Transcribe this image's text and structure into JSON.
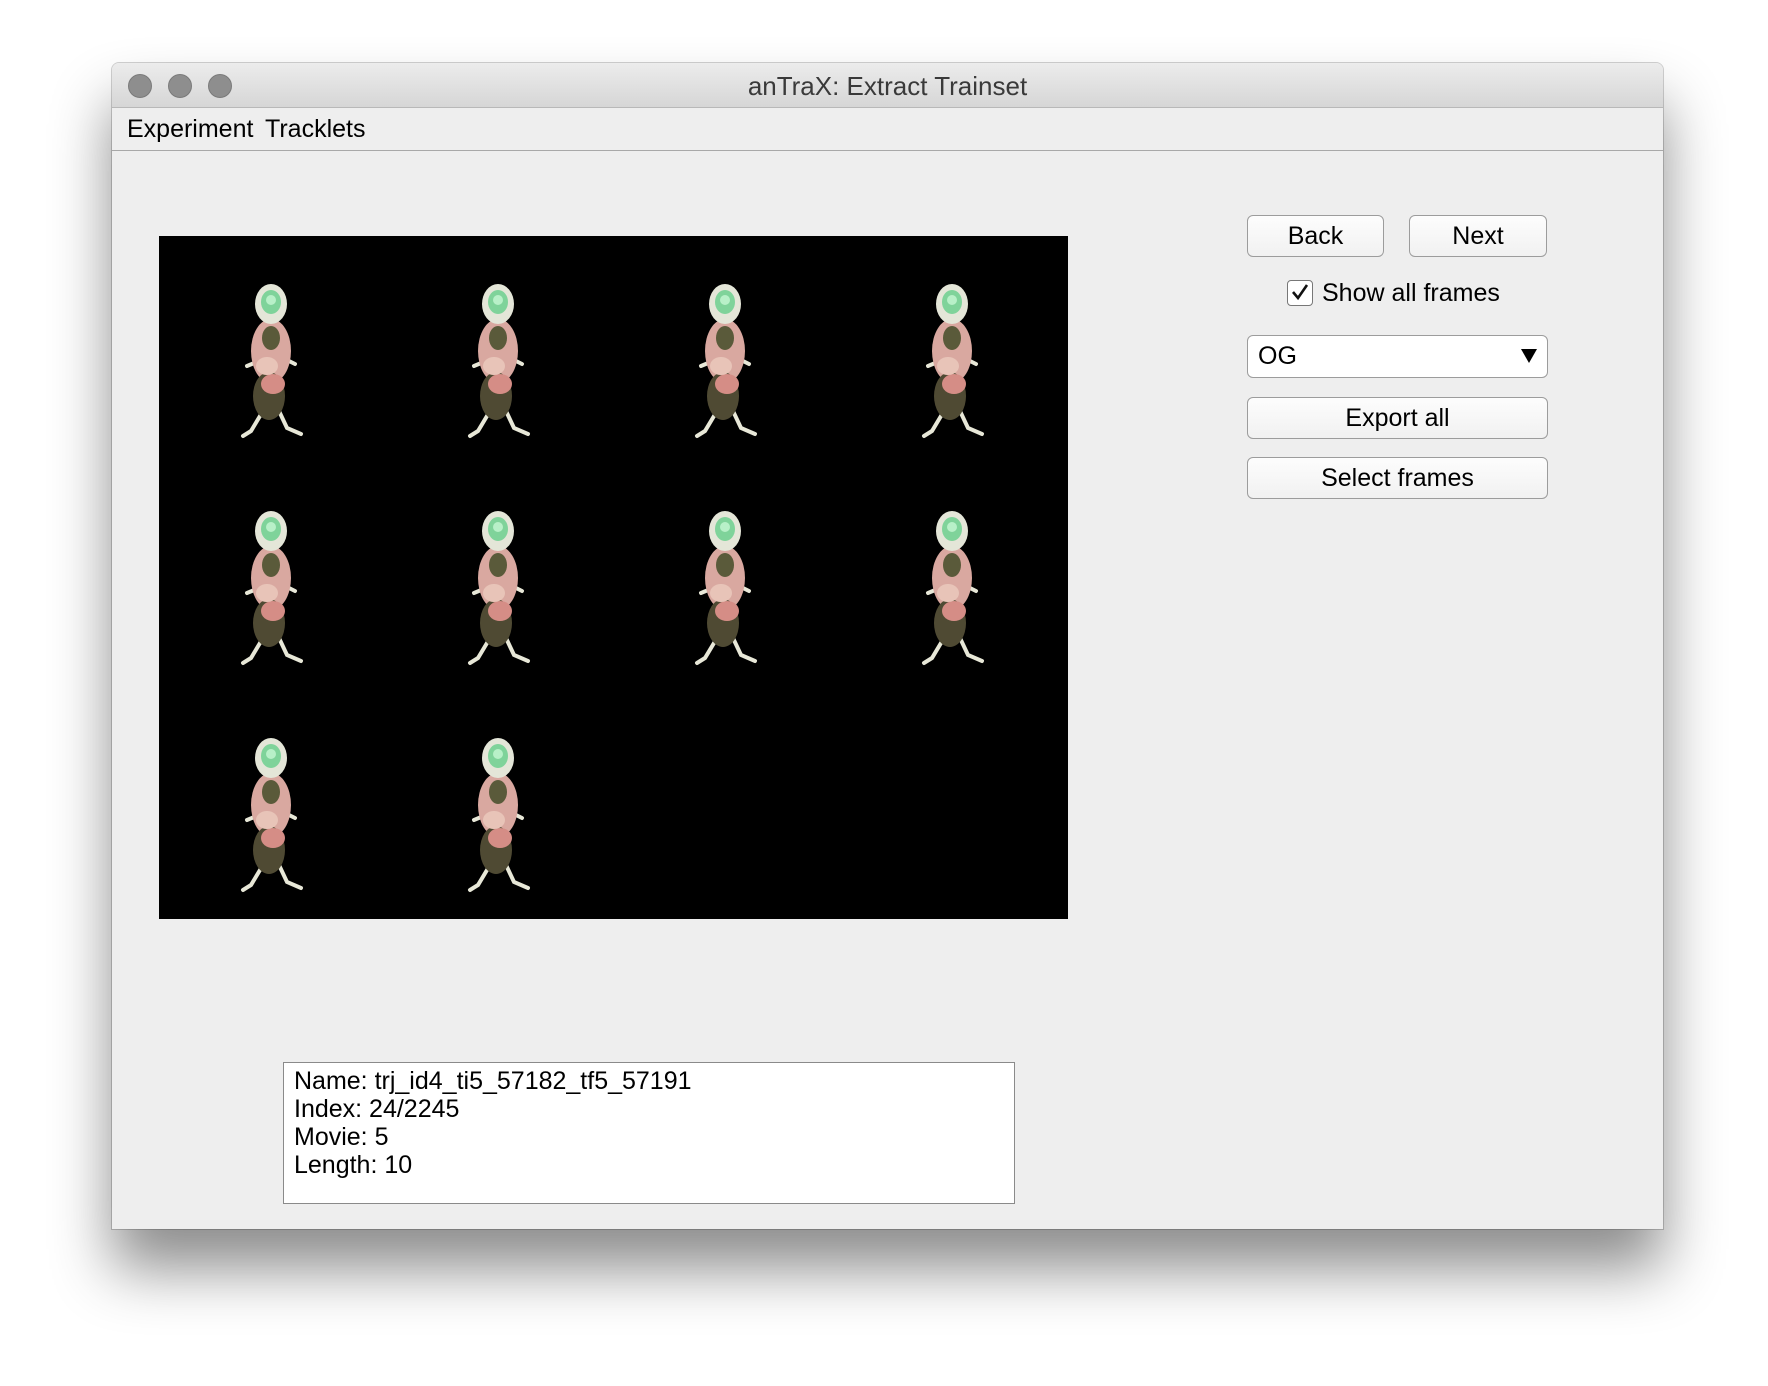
{
  "window": {
    "title": "anTraX: Extract Trainset"
  },
  "menu": {
    "items": [
      "Experiment",
      "Tracklets"
    ]
  },
  "controls": {
    "back_label": "Back",
    "next_label": "Next",
    "show_all_frames_label": "Show all frames",
    "show_all_frames_checked": true,
    "classifier_selected": "OG",
    "export_all_label": "Export all",
    "select_frames_label": "Select frames"
  },
  "viewer": {
    "frames_shown": 10,
    "columns": 4
  },
  "info": {
    "name": "Name: trj_id4_ti5_57182_tf5_57191",
    "index": "Index: 24/2245",
    "movie": "Movie: 5",
    "length": "Length: 10"
  },
  "colors": {
    "window_bg": "#eeeeee",
    "canvas_bg": "#000000",
    "traffic_light": "#8e8e8e"
  }
}
